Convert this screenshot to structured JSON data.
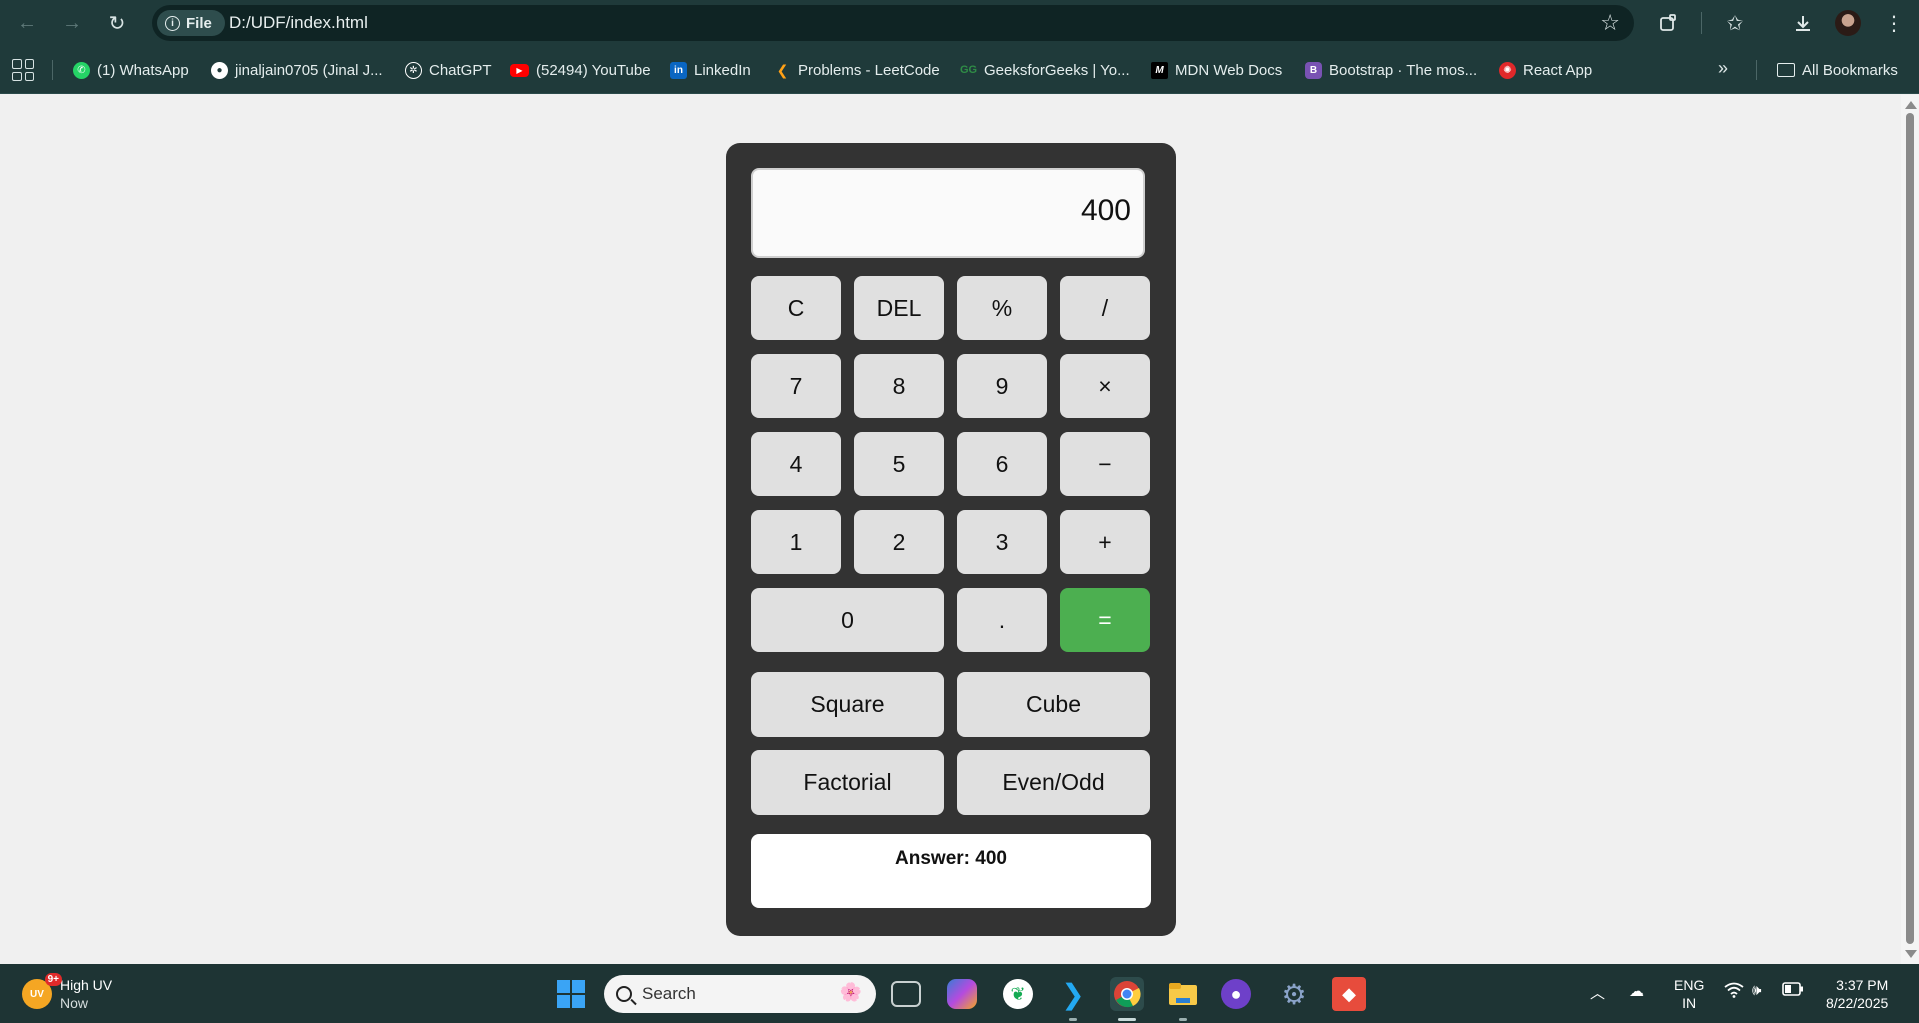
{
  "browser": {
    "url_chip": "File",
    "url": "D:/UDF/index.html"
  },
  "bookmarks": [
    {
      "label": "(1) WhatsApp",
      "icon": "whatsapp-icon",
      "color": "#25d366"
    },
    {
      "label": "jinaljain0705 (Jinal J...",
      "icon": "github-icon",
      "color": "#ffffff"
    },
    {
      "label": "ChatGPT",
      "icon": "chatgpt-icon",
      "color": "#ffffff"
    },
    {
      "label": "(52494) YouTube",
      "icon": "youtube-icon",
      "color": "#ff0000"
    },
    {
      "label": "LinkedIn",
      "icon": "linkedin-icon",
      "color": "#0a66c2"
    },
    {
      "label": "Problems - LeetCode",
      "icon": "leetcode-icon",
      "color": "#ffa116"
    },
    {
      "label": "GeeksforGeeks | Yo...",
      "icon": "geeksforgeeks-icon",
      "color": "#2f8d46"
    },
    {
      "label": "MDN Web Docs",
      "icon": "mdn-icon",
      "color": "#000000"
    },
    {
      "label": "Bootstrap · The mos...",
      "icon": "bootstrap-icon",
      "color": "#7952b3"
    },
    {
      "label": "React App",
      "icon": "react-icon",
      "color": "#e0282a"
    }
  ],
  "all_bookmarks": "All Bookmarks",
  "calculator": {
    "display": "400",
    "keys": {
      "clear": "C",
      "del": "DEL",
      "percent": "%",
      "divide": "/",
      "seven": "7",
      "eight": "8",
      "nine": "9",
      "multiply": "×",
      "four": "4",
      "five": "5",
      "six": "6",
      "minus": "−",
      "one": "1",
      "two": "2",
      "three": "3",
      "plus": "+",
      "zero": "0",
      "dot": ".",
      "equals": "="
    },
    "functions": {
      "square": "Square",
      "cube": "Cube",
      "factorial": "Factorial",
      "even_odd": "Even/Odd"
    },
    "answer": "Answer: 400",
    "accent": "#4caf50"
  },
  "taskbar": {
    "weather_title": "High UV",
    "weather_sub": "Now",
    "uv_badge": "9+",
    "uv_label": "UV",
    "search_placeholder": "Search",
    "lang_line1": "ENG",
    "lang_line2": "IN",
    "time": "3:37 PM",
    "date": "8/22/2025"
  }
}
